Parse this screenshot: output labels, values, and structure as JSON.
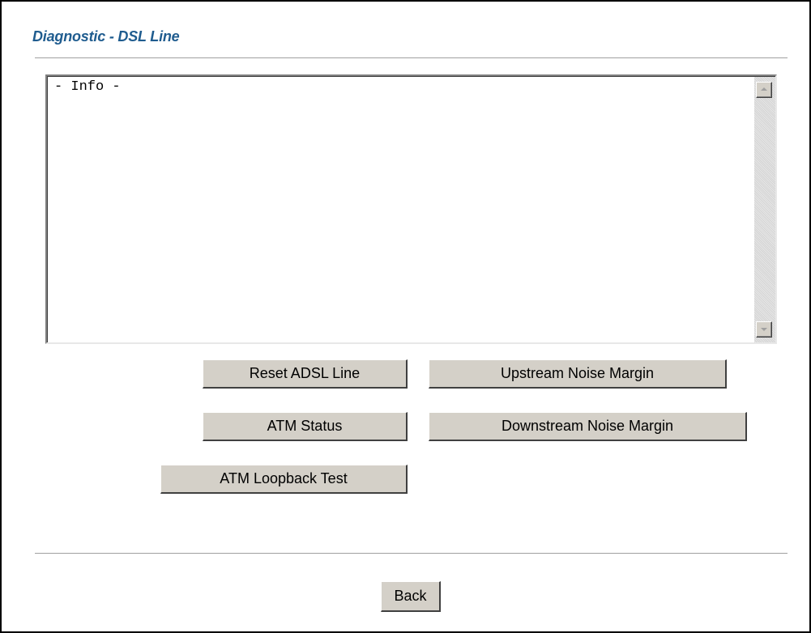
{
  "page": {
    "title": "Diagnostic - DSL Line"
  },
  "info_box": {
    "content": "- Info -"
  },
  "buttons": {
    "reset_adsl_line": "Reset ADSL Line",
    "upstream_noise_margin": "Upstream Noise Margin",
    "atm_status": "ATM Status",
    "downstream_noise_margin": "Downstream Noise Margin",
    "atm_loopback_test": "ATM Loopback Test",
    "back": "Back"
  },
  "icons": {
    "scroll_up": "scroll-up-arrow-icon",
    "scroll_down": "scroll-down-arrow-icon"
  },
  "colors": {
    "title": "#1f5c8f",
    "button_face": "#d4d0c8",
    "rule": "#a0a0a0"
  }
}
